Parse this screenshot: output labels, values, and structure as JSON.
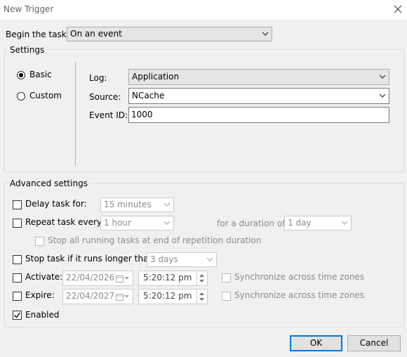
{
  "window": {
    "title": "New Trigger"
  },
  "begin": {
    "label": "Begin the task:",
    "value": "On an event"
  },
  "settings": {
    "group_label": "Settings",
    "radio_basic": "Basic",
    "radio_custom": "Custom",
    "selected": "Basic",
    "log_label": "Log:",
    "log_value": "Application",
    "source_label": "Source:",
    "source_value": "NCache",
    "eventid_label": "Event ID:",
    "eventid_value": "1000"
  },
  "advanced": {
    "group_label": "Advanced settings",
    "delay_label": "Delay task for:",
    "delay_value": "15 minutes",
    "repeat_label": "Repeat task every:",
    "repeat_value": "1 hour",
    "duration_label": "for a duration of:",
    "duration_value": "1 day",
    "stop_all_label": "Stop all running tasks at end of repetition duration",
    "stop_if_label": "Stop task if it runs longer than:",
    "stop_if_value": "3 days",
    "activate_label": "Activate:",
    "activate_date": "22/04/2026",
    "activate_time": "5:20:12 pm",
    "expire_label": "Expire:",
    "expire_date": "22/04/2027",
    "expire_time": "5:20:12 pm",
    "sync_label": "Synchronize across time zones",
    "enabled_label": "Enabled",
    "enabled_checked": true
  },
  "buttons": {
    "ok": "OK",
    "cancel": "Cancel"
  },
  "icons": {
    "close": "close-icon",
    "dropdown": "chevron-down-icon",
    "calendar": "calendar-icon",
    "check": "check-icon"
  }
}
